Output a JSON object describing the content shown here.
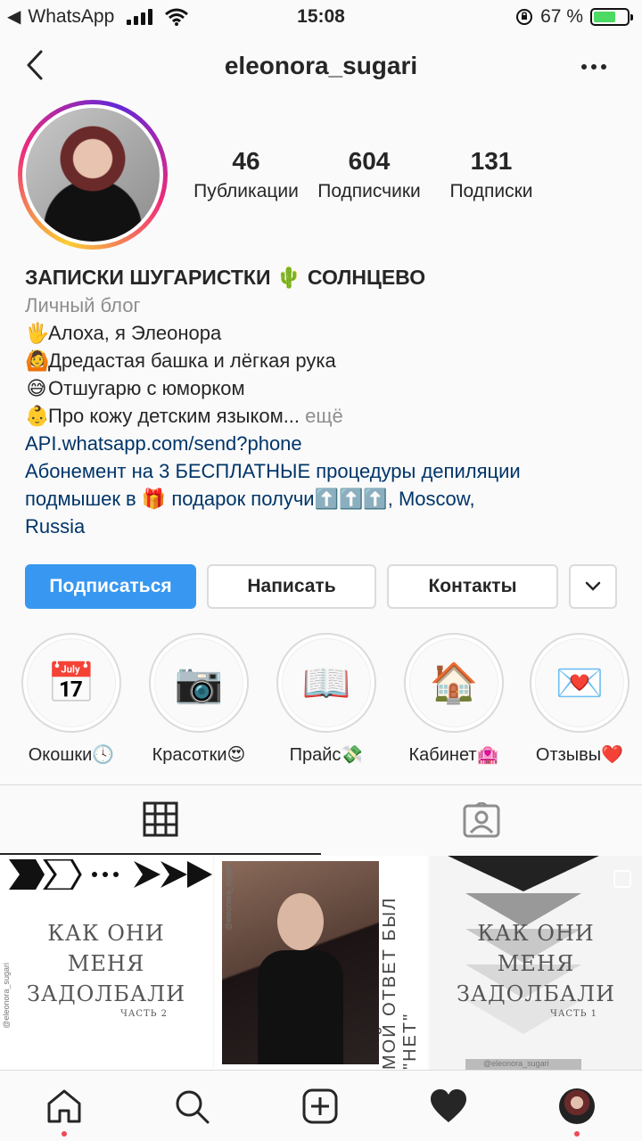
{
  "status_bar": {
    "back_app": "◀",
    "app_name": "WhatsApp",
    "time": "15:08",
    "battery_text": "67 %",
    "battery_level": 0.67
  },
  "nav": {
    "username": "eleonora_sugari"
  },
  "profile": {
    "stats": [
      {
        "value": "46",
        "label": "Публикации"
      },
      {
        "value": "604",
        "label": "Подписчики"
      },
      {
        "value": "131",
        "label": "Подписки"
      }
    ],
    "name": "ЗАПИСКИ ШУГАРИСТКИ 🌵 СОЛНЦЕВО",
    "category": "Личный блог",
    "bio_lines": [
      {
        "emoji": "🖐",
        "text": "Алоха, я Элеонора"
      },
      {
        "emoji": "🙆",
        "text": "Дредастая башка и лёгкая рука"
      },
      {
        "emoji": "😅",
        "text": "Отшугарю с юморком"
      },
      {
        "emoji": "👶",
        "text": "Про кожу детским языком..."
      }
    ],
    "more_label": "ещё",
    "link": "API.whatsapp.com/send?phone",
    "promo_line1": "Абонемент на 3 БЕСПЛАТНЫЕ процедуры депиляции",
    "promo_line2": "подмышек в 🎁 подарок получи⬆️⬆️⬆️, Moscow,",
    "promo_line3": "Russia"
  },
  "actions": {
    "follow": "Подписаться",
    "message": "Написать",
    "contacts": "Контакты"
  },
  "highlights": [
    {
      "icon": "calendar-icon",
      "glyph": "📅",
      "label": "Окошки🕓"
    },
    {
      "icon": "camera-icon",
      "glyph": "📷",
      "label": "Красотки😍"
    },
    {
      "icon": "book-icon",
      "glyph": "📖",
      "label": "Прайс💸"
    },
    {
      "icon": "house-icon",
      "glyph": "🏠",
      "label": "Кабинет🏩"
    },
    {
      "icon": "envelope-icon",
      "glyph": "💌",
      "label": "Отзывы❤️"
    }
  ],
  "posts": [
    {
      "text_lines": [
        "КАК ОНИ",
        "МЕНЯ",
        "ЗАДОЛБАЛИ"
      ],
      "sub": "ЧАСТЬ 2",
      "watermark": "@eleonora_sugari"
    },
    {
      "vertical_text": "МОЙ ОТВЕТ БЫЛ \"НЕТ\"",
      "watermark": "@eleonora_sugari"
    },
    {
      "text_lines": [
        "КАК ОНИ",
        "МЕНЯ",
        "ЗАДОЛБАЛИ"
      ],
      "sub": "ЧАСТЬ 1",
      "watermark": "@eleonora_sugari"
    }
  ],
  "colors": {
    "follow_button": "#3897f0",
    "link": "#003569",
    "notification_dot": "#ed4956"
  }
}
